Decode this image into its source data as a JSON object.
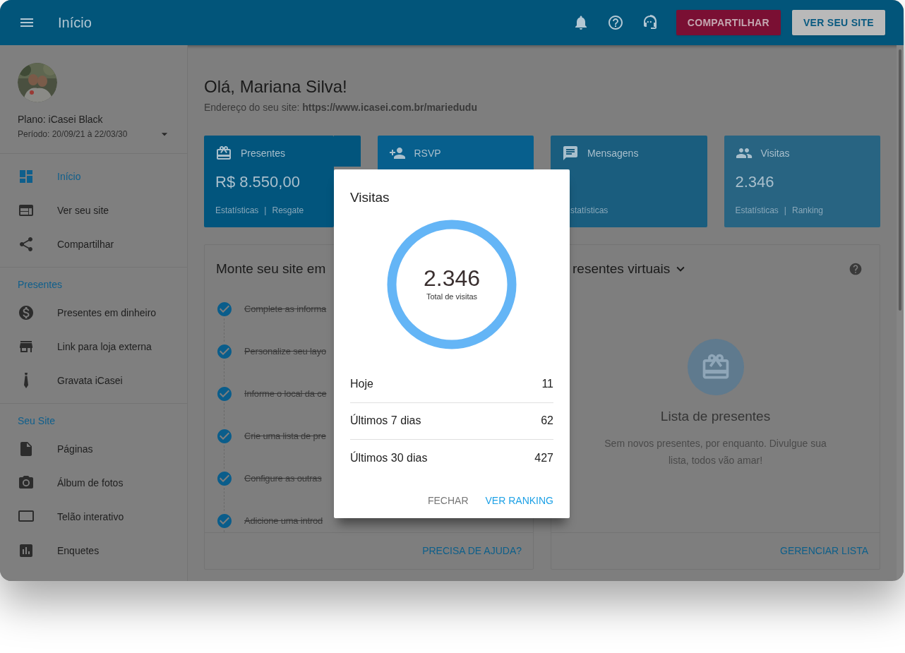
{
  "app_bar": {
    "title": "Início",
    "buttons": [
      {
        "label": "COMPARTILHAR",
        "kind": "primary"
      },
      {
        "label": "VER SEU SITE",
        "kind": "secondary"
      }
    ]
  },
  "sidebar": {
    "plan": "Plano: iCasei Black",
    "period": "Período: 20/09/21 à 22/03/30",
    "sections": [
      {
        "items": [
          {
            "label": "Início",
            "selected": true
          },
          {
            "label": "Ver seu site",
            "selected": false
          },
          {
            "label": "Compartilhar",
            "selected": false
          }
        ]
      },
      {
        "heading": "Presentes",
        "items": [
          {
            "label": "Presentes em dinheiro",
            "selected": false
          },
          {
            "label": "Link para loja externa",
            "selected": false
          },
          {
            "label": "Gravata iCasei",
            "selected": false
          }
        ]
      },
      {
        "heading": "Seu Site",
        "items": [
          {
            "label": "Páginas",
            "selected": false
          },
          {
            "label": "Álbum de fotos",
            "selected": false
          },
          {
            "label": "Telão interativo",
            "selected": false
          },
          {
            "label": "Enquetes",
            "selected": false
          }
        ]
      }
    ]
  },
  "greeting": "Olá, Mariana Silva!",
  "address": "Endereço do seu site: **https://www.icasei.com.br/mariedudu**",
  "stat_cards": [
    {
      "title": "Presentes",
      "value": "R$ 8.550,00",
      "links": [
        "Estatísticas",
        "Resgate"
      ],
      "separator": "|",
      "color": "#02557d"
    },
    {
      "title": "RSVP",
      "color": "#075f8d"
    },
    {
      "title": "Mensagens",
      "links": [
        "statísticas"
      ],
      "color": "#1a5d7e"
    },
    {
      "title": "Visitas",
      "value": "2.346",
      "links": [
        "Estatísticas",
        "Ranking"
      ],
      "separator": "|",
      "color": "#286482"
    }
  ],
  "setup_panel": {
    "title": "Monte seu site em",
    "steps": [
      {
        "label": "Complete as informa",
        "done": true
      },
      {
        "label": "Personalize seu layo",
        "done": true
      },
      {
        "label": "Informe o local da ce",
        "done": true
      },
      {
        "label": "Crie uma lista de pre",
        "done": true
      },
      {
        "label": "Configure as outras",
        "done": true
      },
      {
        "label": "Adicione uma introd",
        "done": true
      }
    ],
    "action": "PRECISA DE AJUDA?"
  },
  "gifts_panel": {
    "title": "resentes virtuais",
    "empty_title": "Lista de presentes",
    "empty_text": "Sem novos presentes, por enquanto. Divulgue sua lista, todos vão amar!",
    "action": "GERENCIAR LISTA"
  },
  "dialog": {
    "title": "Visitas",
    "total": "2.346",
    "total_label": "Total de visitas",
    "rows": [
      {
        "label": "Hoje",
        "value": "11"
      },
      {
        "label": "Últimos 7 dias",
        "value": "62"
      },
      {
        "label": "Últimos 30 dias",
        "value": "427"
      }
    ],
    "buttons": [
      {
        "label": "FECHAR",
        "kind": "secondary"
      },
      {
        "label": "VER RANKING",
        "kind": "primary"
      }
    ]
  }
}
